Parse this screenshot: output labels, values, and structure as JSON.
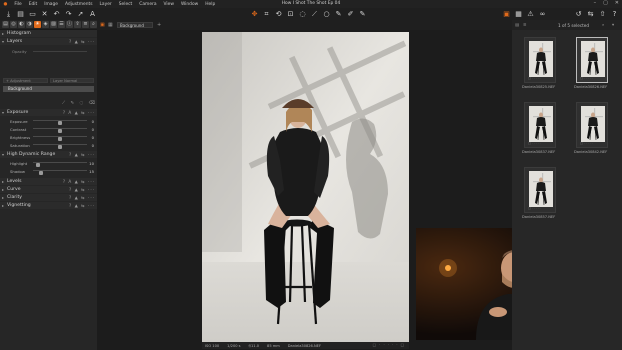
{
  "window": {
    "title": "How I Shot The Shot Ep 04",
    "controls": [
      "–",
      "▢",
      "✕"
    ]
  },
  "menu": [
    "File",
    "Edit",
    "Image",
    "Adjustments",
    "Layer",
    "Select",
    "Camera",
    "View",
    "Window",
    "Help"
  ],
  "left_panel": {
    "sections": {
      "histogram": "Histogram",
      "layers": "Layers",
      "opacity": "Opacity",
      "adjustment": "Adjustment",
      "layer_mode": "Layer Normal",
      "background_layer": "Background",
      "exposure": "Exposure",
      "hdr": "High Dynamic Range",
      "levels": "Levels",
      "curve": "Curve",
      "clarity": "Clarity",
      "vignetting": "Vignetting"
    },
    "exposure_params": [
      {
        "label": "Exposure",
        "value": "0",
        "pos": 0.5
      },
      {
        "label": "Contrast",
        "value": "0",
        "pos": 0.5
      },
      {
        "label": "Brightness",
        "value": "0",
        "pos": 0.5
      },
      {
        "label": "Saturation",
        "value": "0",
        "pos": 0.5
      }
    ],
    "hdr_params": [
      {
        "label": "Highlight",
        "value": "10",
        "pos": 0.1
      },
      {
        "label": "Shadow",
        "value": "15",
        "pos": 0.15
      }
    ]
  },
  "viewer": {
    "variant_select": "Background",
    "footer": {
      "iso": "ISO 100",
      "shutter": "1/200 s",
      "aperture": "f/11.0",
      "focal": "85 mm",
      "filename": "Daniela30826.NEF"
    }
  },
  "browser": {
    "count_label": "1 of 5 selected",
    "thumbs": [
      {
        "name": "Daniela30825.NEF",
        "selected": false
      },
      {
        "name": "Daniela30826.NEF",
        "selected": true
      },
      {
        "name": "Daniela30837.NEF",
        "selected": false
      },
      {
        "name": "Daniela30842.NEF",
        "selected": false
      },
      {
        "name": "Daniela30857.NEF",
        "selected": false
      }
    ]
  },
  "colors": {
    "accent": "#e06a1b",
    "panel": "#262626",
    "viewer_bg": "#1c1c1c"
  }
}
